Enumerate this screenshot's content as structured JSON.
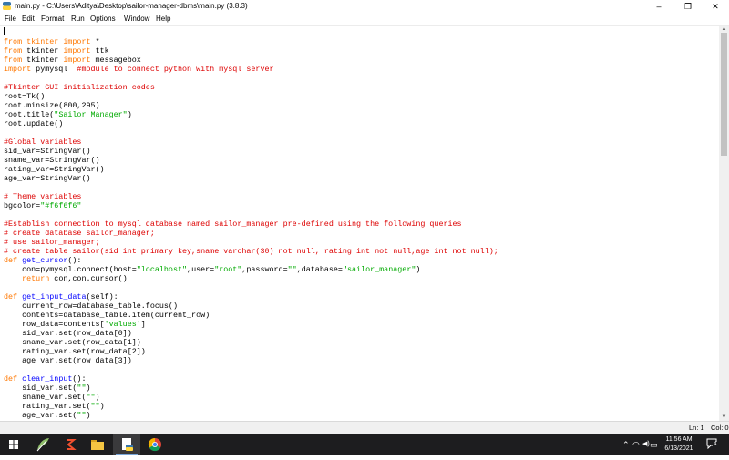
{
  "window": {
    "title": "main.py - C:\\Users\\Aditya\\Desktop\\sailor-manager-dbms\\main.py (3.8.3)",
    "minimize_glyph": "–",
    "maximize_glyph": "❐",
    "close_glyph": "✕"
  },
  "menu": {
    "file": "File",
    "edit": "Edit",
    "format": "Format",
    "run": "Run",
    "options": "Options",
    "window": "Window",
    "help": "Help"
  },
  "code_lines": [
    [],
    [
      [
        "from tkinter ",
        "kw"
      ],
      [
        "import",
        "kw"
      ],
      [
        " *",
        ""
      ]
    ],
    [
      [
        "from",
        "kw"
      ],
      [
        " tkinter ",
        ""
      ],
      [
        "import",
        "kw"
      ],
      [
        " ttk",
        ""
      ]
    ],
    [
      [
        "from",
        "kw"
      ],
      [
        " tkinter ",
        ""
      ],
      [
        "import",
        "kw"
      ],
      [
        " messagebox",
        ""
      ]
    ],
    [
      [
        "import",
        "kw"
      ],
      [
        " pymysql  ",
        ""
      ],
      [
        "#module to connect python with mysql server",
        "cm"
      ]
    ],
    [],
    [
      [
        "#Tkinter GUI initialization codes",
        "cm"
      ]
    ],
    [
      [
        "root=Tk()",
        ""
      ]
    ],
    [
      [
        "root.minsize(800,295)",
        ""
      ]
    ],
    [
      [
        "root.title(",
        ""
      ],
      [
        "\"Sailor Manager\"",
        "str"
      ],
      [
        ")",
        ""
      ]
    ],
    [
      [
        "root.update()",
        ""
      ]
    ],
    [],
    [
      [
        "#Global variables",
        "cm"
      ]
    ],
    [
      [
        "sid_var=StringVar()",
        ""
      ]
    ],
    [
      [
        "sname_var=StringVar()",
        ""
      ]
    ],
    [
      [
        "rating_var=StringVar()",
        ""
      ]
    ],
    [
      [
        "age_var=StringVar()",
        ""
      ]
    ],
    [],
    [
      [
        "# Theme variables",
        "cm"
      ]
    ],
    [
      [
        "bgcolor=",
        ""
      ],
      [
        "\"#f6f6f6\"",
        "str"
      ]
    ],
    [],
    [
      [
        "#Establish connection to mysql database named sailor_manager pre-defined using the following queries",
        "cm"
      ]
    ],
    [
      [
        "# create database sailor_manager;",
        "cm"
      ]
    ],
    [
      [
        "# use sailor_manager;",
        "cm"
      ]
    ],
    [
      [
        "# create table sailor(sid int primary key,sname varchar(30) not null, rating int not null,age int not null);",
        "cm"
      ]
    ],
    [
      [
        "def",
        "kw"
      ],
      [
        " ",
        ""
      ],
      [
        "get_cursor",
        "fn"
      ],
      [
        "():",
        ""
      ]
    ],
    [
      [
        "    con=pymysql.connect(host=",
        ""
      ],
      [
        "\"localhost\"",
        "str"
      ],
      [
        ",user=",
        ""
      ],
      [
        "\"root\"",
        "str"
      ],
      [
        ",password=",
        ""
      ],
      [
        "\"\"",
        "str"
      ],
      [
        ",database=",
        ""
      ],
      [
        "\"sailor_manager\"",
        "str"
      ],
      [
        ")",
        ""
      ]
    ],
    [
      [
        "    ",
        ""
      ],
      [
        "return",
        "kw"
      ],
      [
        " con,con.cursor()",
        ""
      ]
    ],
    [],
    [
      [
        "def",
        "kw"
      ],
      [
        " ",
        ""
      ],
      [
        "get_input_data",
        "fn"
      ],
      [
        "(self):",
        ""
      ]
    ],
    [
      [
        "    current_row=database_table.focus()",
        ""
      ]
    ],
    [
      [
        "    contents=database_table.item(current_row)",
        ""
      ]
    ],
    [
      [
        "    row_data=contents[",
        ""
      ],
      [
        "'values'",
        "str"
      ],
      [
        "]",
        ""
      ]
    ],
    [
      [
        "    sid_var.set(row_data[0])",
        ""
      ]
    ],
    [
      [
        "    sname_var.set(row_data[1])",
        ""
      ]
    ],
    [
      [
        "    rating_var.set(row_data[2])",
        ""
      ]
    ],
    [
      [
        "    age_var.set(row_data[3])",
        ""
      ]
    ],
    [],
    [
      [
        "def",
        "kw"
      ],
      [
        " ",
        ""
      ],
      [
        "clear_input",
        "fn"
      ],
      [
        "():",
        ""
      ]
    ],
    [
      [
        "    sid_var.set(",
        ""
      ],
      [
        "\"\"",
        "str"
      ],
      [
        ")",
        ""
      ]
    ],
    [
      [
        "    sname_var.set(",
        ""
      ],
      [
        "\"\"",
        "str"
      ],
      [
        ")",
        ""
      ]
    ],
    [
      [
        "    rating_var.set(",
        ""
      ],
      [
        "\"\"",
        "str"
      ],
      [
        ")",
        ""
      ]
    ],
    [
      [
        "    age_var.set(",
        ""
      ],
      [
        "\"\"",
        "str"
      ],
      [
        ")",
        ""
      ]
    ]
  ],
  "status": {
    "line": "Ln: 1",
    "col": "Col: 0"
  },
  "taskbar": {
    "time": "11:56 AM",
    "date": "6/13/2021",
    "notifications_count": "4",
    "tray_up_glyph": "⌃",
    "wifi_glyph": "◠",
    "volume_glyph": "◀)",
    "language_glyph": "▭"
  },
  "colors": {
    "keyword": "#ff7700",
    "string": "#00aa00",
    "comment": "#dd0000",
    "definition": "#0000ff",
    "taskbar_bg": "#1d1d1f"
  }
}
